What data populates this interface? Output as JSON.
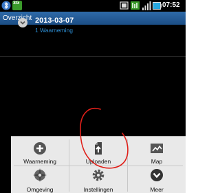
{
  "statusbar": {
    "network": "3G",
    "time": "07:52",
    "icons": [
      "bluetooth-icon",
      "network-3g-icon",
      "sync-icon",
      "data-icon",
      "signal-icon",
      "battery-icon"
    ]
  },
  "titlebar": {
    "title": "Overzicht"
  },
  "list": [
    {
      "date": "2013-03-07",
      "subtitle": "1 Waarneming"
    }
  ],
  "menu": {
    "items": [
      {
        "label": "Waarneming",
        "icon": "add-icon"
      },
      {
        "label": "Uploaden",
        "icon": "upload-icon"
      },
      {
        "label": "Map",
        "icon": "map-icon"
      },
      {
        "label": "Omgeving",
        "icon": "compass-icon"
      },
      {
        "label": "Instellingen",
        "icon": "settings-icon"
      },
      {
        "label": "Meer",
        "icon": "more-icon"
      }
    ]
  },
  "colors": {
    "title_bar": "#2e6aa8",
    "accent_text": "#2d8fd5",
    "menu_bg": "#e9e9e9",
    "annotation": "#e0201a"
  }
}
